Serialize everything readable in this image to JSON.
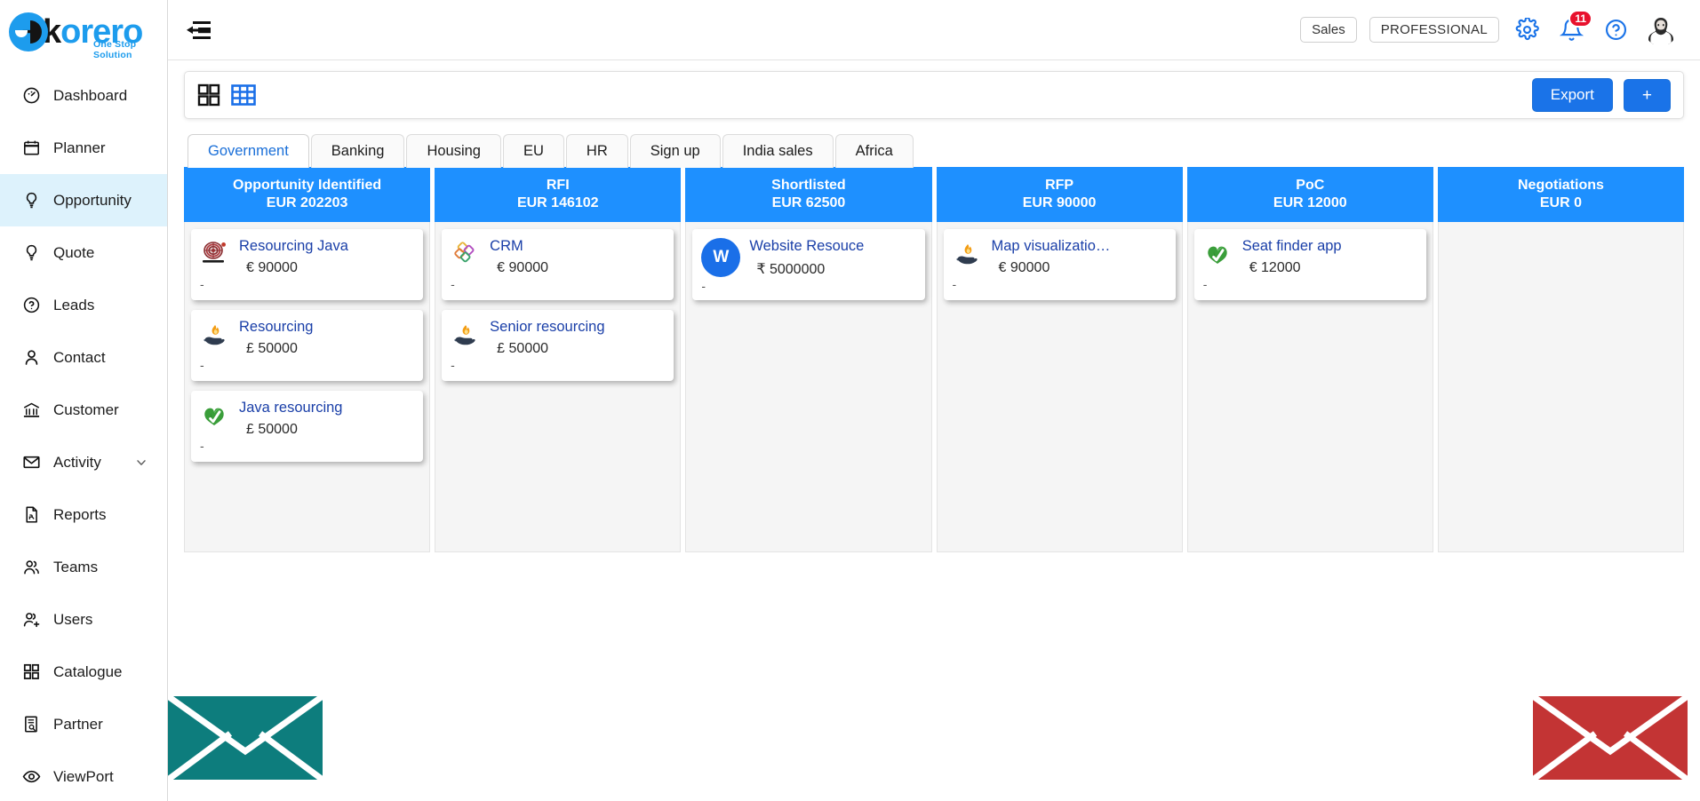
{
  "brand": {
    "name_k": "k",
    "name_rest": "orero",
    "tagline": "One Stop Solution",
    "logo_icon": "korero-circle-logo",
    "accent_color": "#1d9ced"
  },
  "sidebar": {
    "items": [
      {
        "label": "Dashboard",
        "icon": "speedometer-icon",
        "active": false
      },
      {
        "label": "Planner",
        "icon": "calendar-icon",
        "active": false
      },
      {
        "label": "Opportunity",
        "icon": "lightbulb-icon",
        "active": true
      },
      {
        "label": "Quote",
        "icon": "lightbulb-icon",
        "active": false
      },
      {
        "label": "Leads",
        "icon": "question-circle-icon",
        "active": false
      },
      {
        "label": "Contact",
        "icon": "person-icon",
        "active": false
      },
      {
        "label": "Customer",
        "icon": "bank-icon",
        "active": false
      },
      {
        "label": "Activity",
        "icon": "envelope-icon",
        "active": false,
        "chevron": "chevron-down-icon"
      },
      {
        "label": "Reports",
        "icon": "file-pdf-icon",
        "active": false
      },
      {
        "label": "Teams",
        "icon": "people-icon",
        "active": false
      },
      {
        "label": "Users",
        "icon": "person-add-icon",
        "active": false
      },
      {
        "label": "Catalogue",
        "icon": "grid-icon",
        "active": false
      },
      {
        "label": "Partner",
        "icon": "file-search-icon",
        "active": false
      },
      {
        "label": "ViewPort",
        "icon": "eye-icon",
        "active": false
      }
    ]
  },
  "topbar": {
    "menu_toggle_icon": "menu-collapse-icon",
    "module_label": "Sales",
    "plan_label": "PROFESSIONAL",
    "settings_icon": "gear-icon",
    "notifications_icon": "bell-icon",
    "notifications_count": "11",
    "help_icon": "question-circle-icon",
    "avatar_icon": "user-avatar"
  },
  "toolbar": {
    "card_view_icon": "grid-view-icon",
    "table_view_icon": "table-view-icon",
    "active_view": "table",
    "export_label": "Export",
    "add_label": "+"
  },
  "tabs": [
    {
      "label": "Government",
      "active": true
    },
    {
      "label": "Banking",
      "active": false
    },
    {
      "label": "Housing",
      "active": false
    },
    {
      "label": "EU",
      "active": false
    },
    {
      "label": "HR",
      "active": false
    },
    {
      "label": "Sign up",
      "active": false
    },
    {
      "label": "India sales",
      "active": false
    },
    {
      "label": "Africa",
      "active": false
    }
  ],
  "board": {
    "columns": [
      {
        "title": "Opportunity Identified",
        "total": "EUR 202203",
        "cards": [
          {
            "title": "Resourcing Java",
            "amount": "€ 90000",
            "footer": "-",
            "icon": "dartboard-icon"
          },
          {
            "title": "Resourcing",
            "amount": "£ 50000",
            "footer": "-",
            "icon": "hand-flame-icon"
          },
          {
            "title": "Java resourcing",
            "amount": "£ 50000",
            "footer": "-",
            "icon": "green-leaf-check-icon"
          }
        ]
      },
      {
        "title": "RFI",
        "total": "EUR 146102",
        "cards": [
          {
            "title": "CRM",
            "amount": "€ 90000",
            "footer": "-",
            "icon": "four-diamonds-icon"
          },
          {
            "title": "Senior resourcing",
            "amount": "£ 50000",
            "footer": "-",
            "icon": "hand-flame-icon"
          }
        ]
      },
      {
        "title": "Shortlisted",
        "total": "EUR 62500",
        "cards": [
          {
            "title": "Website Resouce",
            "amount": "₹  5000000",
            "footer": "-",
            "icon": "avatar-initial",
            "initial": "W"
          }
        ]
      },
      {
        "title": "RFP",
        "total": "EUR 90000",
        "cards": [
          {
            "title": "Map visualizatio…",
            "amount": "€ 90000",
            "footer": "-",
            "icon": "hand-flame-icon"
          }
        ]
      },
      {
        "title": "PoC",
        "total": "EUR 12000",
        "cards": [
          {
            "title": "Seat finder app",
            "amount": "€ 12000",
            "footer": "-",
            "icon": "green-leaf-check-icon"
          }
        ]
      },
      {
        "title": "Negotiations",
        "total": "EUR 0",
        "cards": []
      }
    ],
    "header_color": "#1e90ff"
  },
  "decorations": {
    "envelope_left_icon": "envelope-shape",
    "envelope_left_color": "#0d7d7d",
    "envelope_right_icon": "envelope-shape",
    "envelope_right_color": "#c33434"
  }
}
